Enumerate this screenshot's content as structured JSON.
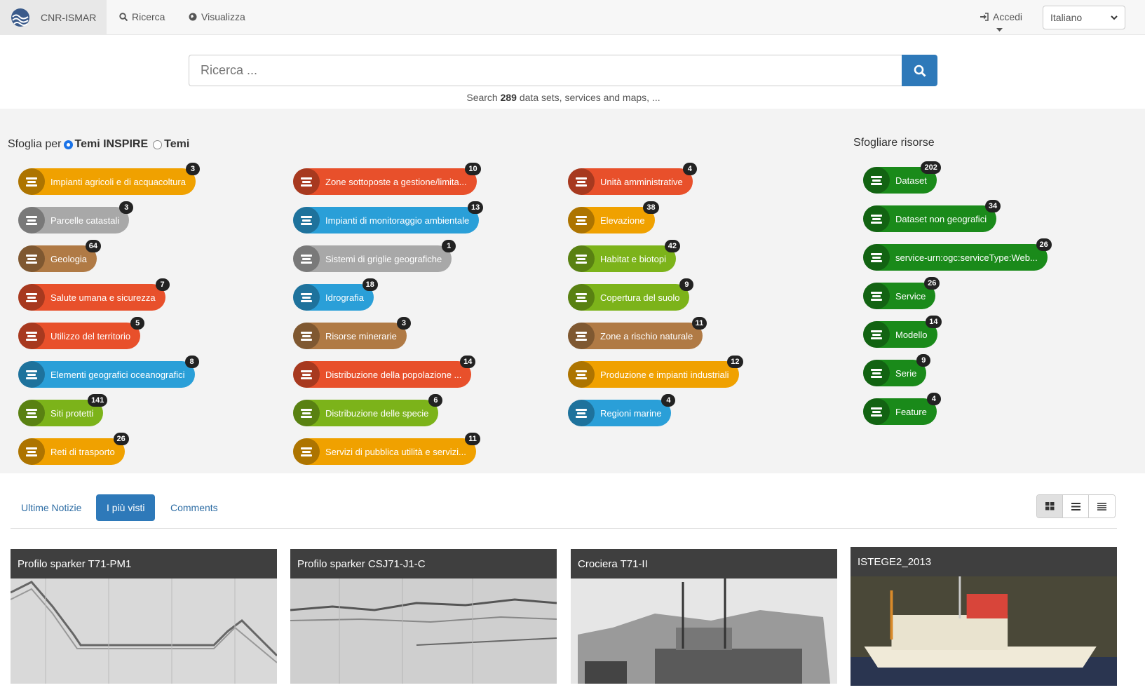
{
  "header": {
    "brand": "CNR-ISMAR",
    "nav": [
      {
        "label": "Ricerca",
        "icon": "search-icon"
      },
      {
        "label": "Visualizza",
        "icon": "globe-icon"
      }
    ],
    "login": "Accedi",
    "language": "Italiano"
  },
  "search": {
    "placeholder": "Ricerca ...",
    "sub_prefix": "Search ",
    "sub_count": "289",
    "sub_suffix": " data sets, services and maps, ..."
  },
  "browse": {
    "prefix": "Sfoglia per",
    "option1": "Temi INSPIRE",
    "option2": "Temi",
    "resources_title": "Sfogliare risorse",
    "col1": [
      {
        "label": "Impianti agricoli e di acquacoltura",
        "count": "3",
        "color": "#f0a100"
      },
      {
        "label": "Parcelle catastali",
        "count": "3",
        "color": "#a8a8a8"
      },
      {
        "label": "Geologia",
        "count": "64",
        "color": "#b07a45"
      },
      {
        "label": "Salute umana e sicurezza",
        "count": "7",
        "color": "#e8502b"
      },
      {
        "label": "Utilizzo del territorio",
        "count": "5",
        "color": "#e8502b"
      },
      {
        "label": "Elementi geografici oceanografici",
        "count": "8",
        "color": "#2a9fd8"
      },
      {
        "label": "Siti protetti",
        "count": "141",
        "color": "#7cb31a"
      },
      {
        "label": "Reti di trasporto",
        "count": "26",
        "color": "#f0a100"
      }
    ],
    "col2": [
      {
        "label": "Zone sottoposte a gestione/limita...",
        "count": "10",
        "color": "#e8502b"
      },
      {
        "label": "Impianti di monitoraggio ambientale",
        "count": "13",
        "color": "#2a9fd8"
      },
      {
        "label": "Sistemi di griglie geografiche",
        "count": "1",
        "color": "#a8a8a8"
      },
      {
        "label": "Idrografia",
        "count": "18",
        "color": "#2a9fd8"
      },
      {
        "label": "Risorse minerarie",
        "count": "3",
        "color": "#b07a45"
      },
      {
        "label": "Distribuzione della popolazione ...",
        "count": "14",
        "color": "#e8502b"
      },
      {
        "label": "Distribuzione delle specie",
        "count": "6",
        "color": "#7cb31a"
      },
      {
        "label": "Servizi di pubblica utilità e servizi...",
        "count": "11",
        "color": "#f0a100"
      }
    ],
    "col3": [
      {
        "label": "Unità amministrative",
        "count": "4",
        "color": "#e8502b"
      },
      {
        "label": "Elevazione",
        "count": "38",
        "color": "#f0a100"
      },
      {
        "label": "Habitat e biotopi",
        "count": "42",
        "color": "#7cb31a"
      },
      {
        "label": "Copertura del suolo",
        "count": "9",
        "color": "#7cb31a"
      },
      {
        "label": "Zone a rischio naturale",
        "count": "11",
        "color": "#b07a45"
      },
      {
        "label": "Produzione e impianti industriali",
        "count": "12",
        "color": "#f0a100"
      },
      {
        "label": "Regioni marine",
        "count": "4",
        "color": "#2a9fd8"
      }
    ],
    "resources": [
      {
        "label": "Dataset",
        "count": "202",
        "icon": "database-icon"
      },
      {
        "label": "Dataset non geografici",
        "count": "34",
        "icon": "bar-chart-icon"
      },
      {
        "label": "service-urn:ogc:serviceType:Web...",
        "count": "26",
        "icon": "table-icon"
      },
      {
        "label": "Service",
        "count": "26",
        "icon": "cloud-icon"
      },
      {
        "label": "Modello",
        "count": "14",
        "icon": "dashboard-icon"
      },
      {
        "label": "Serie",
        "count": "9",
        "icon": "copy-icon"
      },
      {
        "label": "Feature",
        "count": "4",
        "icon": "tag-icon"
      }
    ],
    "resource_color": "#1a8a1a"
  },
  "tabs": [
    {
      "label": "Ultime Notizie",
      "active": false
    },
    {
      "label": "I più visti",
      "active": true
    },
    {
      "label": "Comments",
      "active": false
    }
  ],
  "cards": [
    {
      "title": "Profilo sparker T71-PM1"
    },
    {
      "title": "Profilo sparker CSJ71-J1-C"
    },
    {
      "title": "Crociera T71-II"
    },
    {
      "title": "ISTEGE2_2013"
    }
  ]
}
